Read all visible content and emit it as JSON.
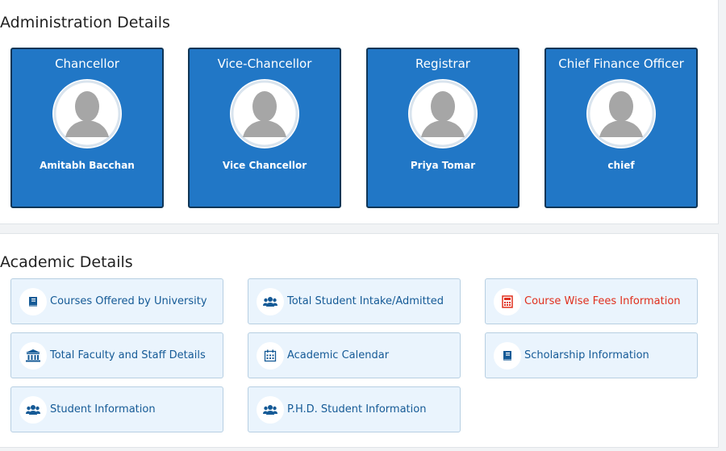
{
  "administration": {
    "title": "Administration Details",
    "cards": [
      {
        "role": "Chancellor",
        "name": "Amitabh Bacchan",
        "icon": "user-avatar-icon"
      },
      {
        "role": "Vice-Chancellor",
        "name": "Vice Chancellor",
        "icon": "user-avatar-icon"
      },
      {
        "role": "Registrar",
        "name": "Priya Tomar",
        "icon": "user-avatar-icon"
      },
      {
        "role": "Chief Finance Officer",
        "name": "chief",
        "icon": "user-avatar-icon"
      }
    ],
    "card_color": "#2177c6"
  },
  "academic": {
    "title": "Academic Details",
    "items": [
      {
        "label": "Courses Offered by University",
        "icon": "book-icon"
      },
      {
        "label": "Total Student Intake/Admitted",
        "icon": "users-icon"
      },
      {
        "label": "Course Wise Fees Information",
        "icon": "calculator-icon",
        "color": "#e0301e"
      },
      {
        "label": "Total Faculty and Staff Details",
        "icon": "institution-icon"
      },
      {
        "label": "Academic Calendar",
        "icon": "calendar-icon"
      },
      {
        "label": "Scholarship Information",
        "icon": "book-icon"
      },
      {
        "label": "Student Information",
        "icon": "users-icon"
      },
      {
        "label": "P.H.D. Student Information",
        "icon": "users-icon"
      }
    ],
    "link_color": "#155a96"
  }
}
